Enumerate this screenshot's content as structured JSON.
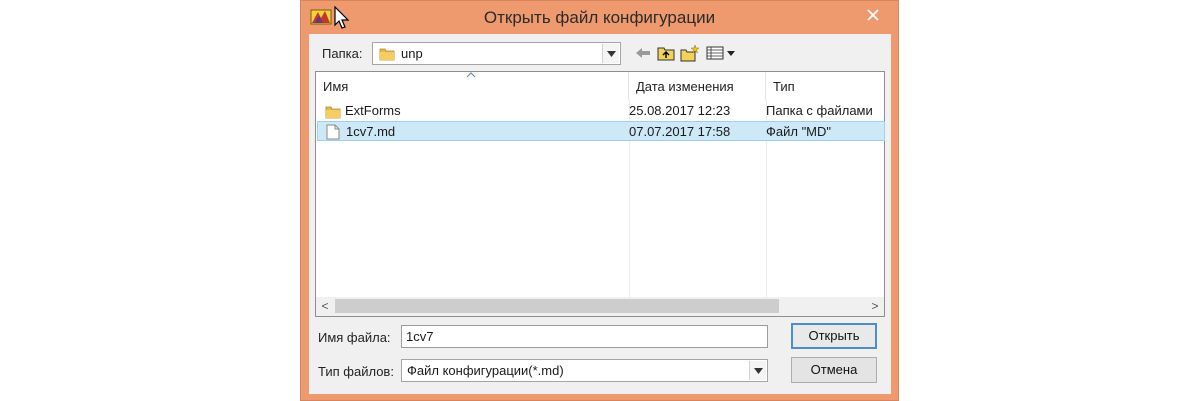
{
  "window": {
    "title": "Открыть файл конфигурации"
  },
  "folder": {
    "label": "Папка:",
    "value": "unp"
  },
  "columns": {
    "name": "Имя",
    "date": "Дата изменения",
    "type": "Тип"
  },
  "files": [
    {
      "name": "ExtForms",
      "date": "25.08.2017 12:23",
      "type": "Папка с файлами",
      "icon": "folder-icon",
      "selected": false
    },
    {
      "name": "1cv7.md",
      "date": "07.07.2017 17:58",
      "type": "Файл \"MD\"",
      "icon": "file-icon",
      "selected": true
    }
  ],
  "filename": {
    "label": "Имя файла:",
    "value": "1cv7"
  },
  "filetype": {
    "label": "Тип файлов:",
    "value": "Файл конфигурации(*.md)"
  },
  "buttons": {
    "open": "Открыть",
    "cancel": "Отмена"
  },
  "scroll": {
    "left": "<",
    "right": ">"
  },
  "colors": {
    "frame": "#ee9a6e",
    "selection": "#cde8f7",
    "default_button_border": "#4a8fc9"
  }
}
